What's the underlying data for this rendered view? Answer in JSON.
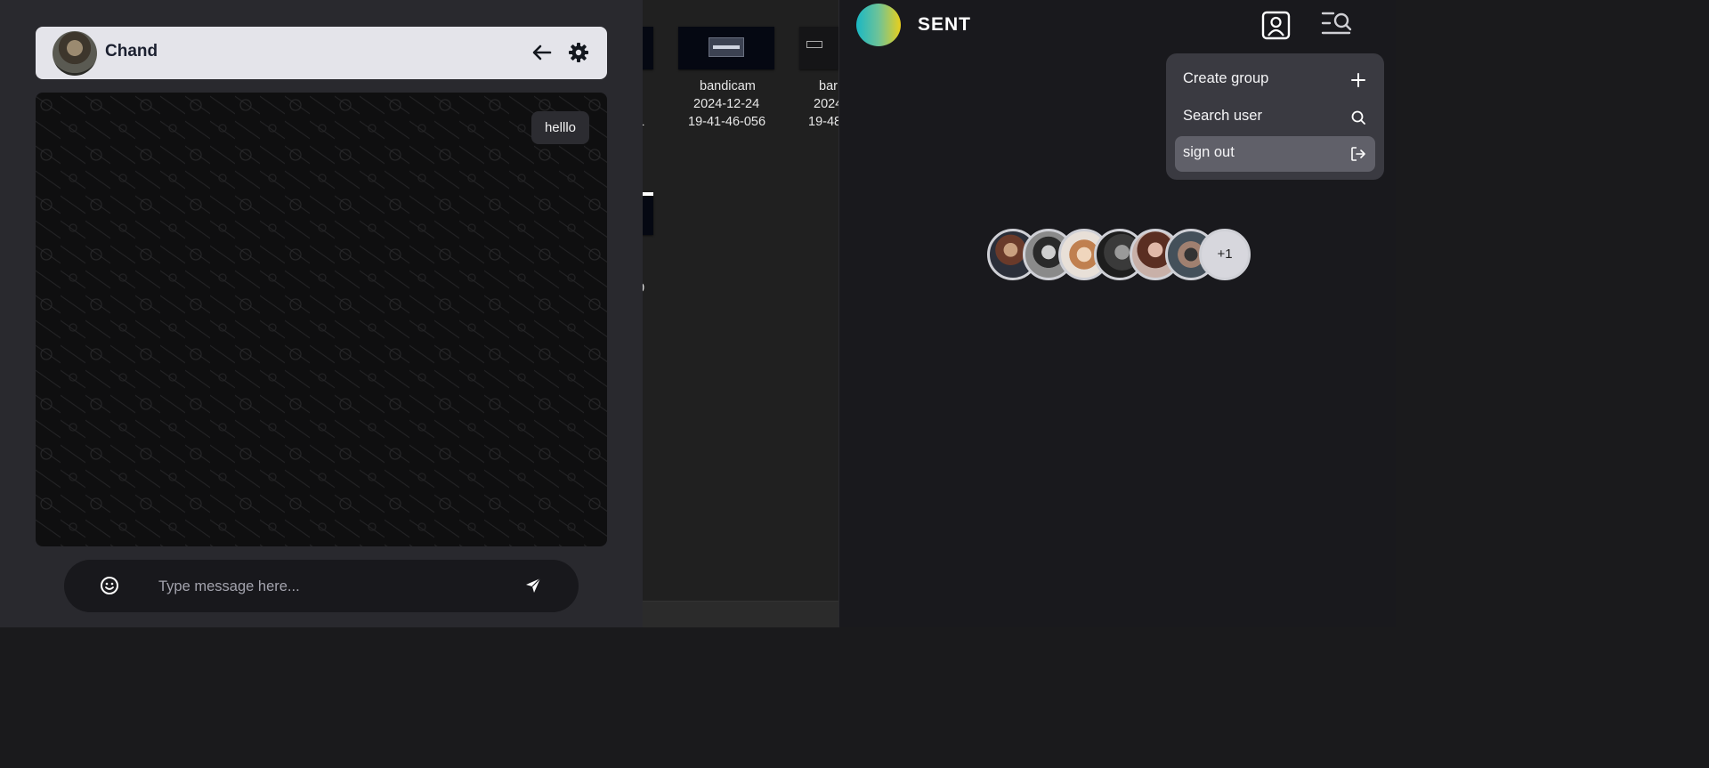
{
  "explorer": {
    "files": [
      {
        "name": "bandicam",
        "date": "2024-12-24",
        "time": "19-41-46-056"
      },
      {
        "name": "bar",
        "date": "2024",
        "time": "19-48"
      }
    ],
    "partial_labels": [
      "1",
      "0"
    ]
  },
  "chat": {
    "contact_name": "Chand",
    "messages": [
      {
        "text": "helllo",
        "side": "right"
      }
    ],
    "input_placeholder": "Type message here...",
    "icons": {
      "back": "arrow-left-icon",
      "settings": "gear-icon",
      "emoji": "smiley-icon",
      "send": "paper-plane-icon"
    }
  },
  "app": {
    "title": "SENT",
    "logo_gradient": [
      "#1ab7c4",
      "#e9cf1c"
    ],
    "header_icons": [
      "profile-icon",
      "menu-search-icon"
    ],
    "menu": [
      {
        "label": "Create group",
        "icon": "plus-icon"
      },
      {
        "label": "Search user",
        "icon": "search-icon"
      },
      {
        "label": "sign out",
        "icon": "sign-out-icon",
        "highlighted": true
      }
    ],
    "group_avatars": {
      "shown": 6,
      "more_label": "+1"
    }
  },
  "colors": {
    "chat_window_bg": "#29292e",
    "header_bg": "#e4e4ea",
    "panel_bg": "#19191d",
    "menu_bg": "#3a3a41",
    "menu_active_bg": "#606069"
  }
}
